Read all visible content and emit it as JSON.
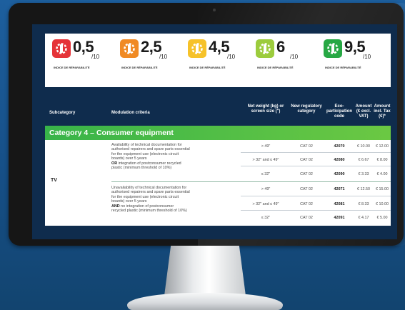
{
  "badges": [
    {
      "score": "0,5",
      "denom": "/10",
      "caption": "INDICE DE RÉPARABILITÉ",
      "color": "#e53338"
    },
    {
      "score": "2,5",
      "denom": "/10",
      "caption": "INDICE DE RÉPARABILITÉ",
      "color": "#f08a24"
    },
    {
      "score": "4,5",
      "denom": "/10",
      "caption": "INDICE DE RÉPARABILITÉ",
      "color": "#f6c229"
    },
    {
      "score": "6",
      "denom": "/10",
      "caption": "INDICE DE RÉPARABILITÉ",
      "color": "#9ccc3d"
    },
    {
      "score": "9,5",
      "denom": "/10",
      "caption": "INDICE DE RÉPARABILITÉ",
      "color": "#27a844"
    }
  ],
  "table": {
    "headers": {
      "subcategory": "Subcategory",
      "criteria": "Modulation criteria",
      "weight": "Net weight (kg) or screen size (\")",
      "category": "New regulatory category",
      "code": "Eco-participation code",
      "excl": "Amount (€ excl. VAT)",
      "incl": "Amount incl. Tax (€)*"
    },
    "category_title": "Category 4 – Consumer equipment",
    "subcategory": "TV",
    "groups": [
      {
        "criteria_lines": [
          "Availability of technical documentation for",
          "authorised repairers and spare parts essential",
          "for the equipment use (electronic circuit",
          "boards) over 5 years"
        ],
        "criteria_keyword": "OR",
        "criteria_tail": " integration of postconsumer recycled",
        "criteria_last": "plastic (minimum threshold of 10%)",
        "rows": [
          {
            "size": "> 49\"",
            "cat": "CAT 02",
            "code": "42070",
            "excl": "€ 10.00",
            "incl": "€ 12.00"
          },
          {
            "size": "> 32\" and ≤ 49\"",
            "cat": "CAT 02",
            "code": "42080",
            "excl": "€ 6.67",
            "incl": "€ 8.00"
          },
          {
            "size": "≤ 32\"",
            "cat": "CAT 02",
            "code": "42090",
            "excl": "€ 3.33",
            "incl": "€ 4.00"
          }
        ]
      },
      {
        "criteria_lines": [
          "Unavailability of technical documentation for",
          "authorised repairers and spare parts essential",
          "for the equipment use (electronic circuit",
          "boards) over 5 years"
        ],
        "criteria_keyword": "AND",
        "criteria_tail": " no integration of postconsumer",
        "criteria_last": "recycled plastic (minimum threshold of 10%)",
        "rows": [
          {
            "size": "> 49\"",
            "cat": "CAT 02",
            "code": "42071",
            "excl": "€ 12.50",
            "incl": "€ 15.00"
          },
          {
            "size": "> 32\" and ≤ 49\"",
            "cat": "CAT 02",
            "code": "42081",
            "excl": "€ 8.33",
            "incl": "€ 10.00"
          },
          {
            "size": "≤ 32\"",
            "cat": "CAT 02",
            "code": "42091",
            "excl": "€ 4.17",
            "incl": "€ 5.00"
          }
        ]
      }
    ]
  }
}
